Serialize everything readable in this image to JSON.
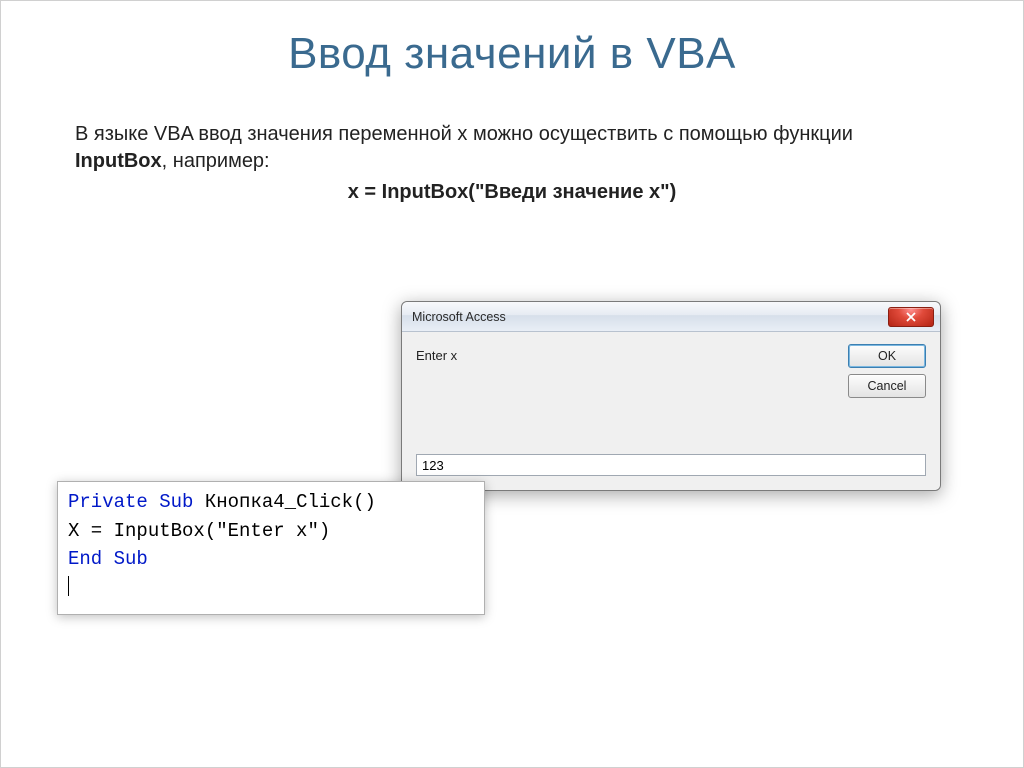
{
  "slide": {
    "title": "Ввод значений в VBA",
    "para1": "В языке VBA ввод значения переменной х можно осуществить с помощью функции ",
    "funcName": "InputBox",
    "para2": ", например:",
    "codeLine": "x = InputBox(\"Введи значение х\")"
  },
  "dialog": {
    "title": "Microsoft Access",
    "prompt": "Enter x",
    "okLabel": "OK",
    "cancelLabel": "Cancel",
    "inputValue": "123"
  },
  "code": {
    "kw_private": "Private",
    "kw_sub": "Sub",
    "subName": " Кнопка4_Click()",
    "line2": "X = InputBox(\"Enter x\")",
    "kw_end": "End",
    "kw_sub2": "Sub"
  }
}
